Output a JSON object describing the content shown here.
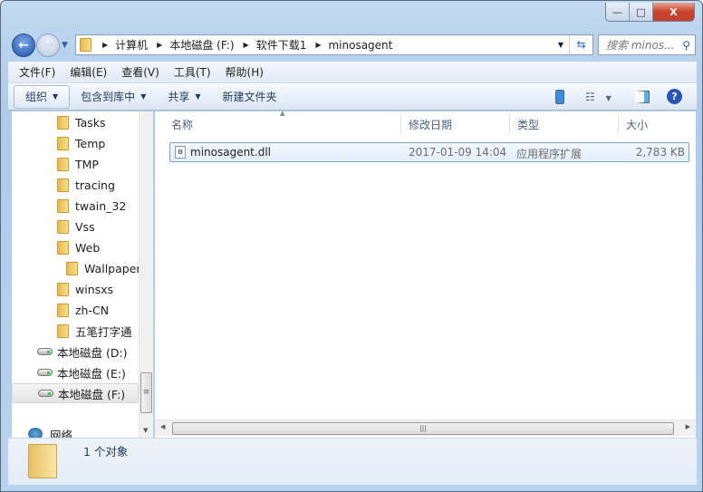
{
  "window": {
    "min": "—",
    "max": "□",
    "close": "X"
  },
  "address": {
    "crumbs": [
      "计算机",
      "本地磁盘 (F:)",
      "软件下载1",
      "minosagent"
    ]
  },
  "search": {
    "placeholder": "搜索 minos..."
  },
  "menu": [
    "文件(F)",
    "编辑(E)",
    "查看(V)",
    "工具(T)",
    "帮助(H)"
  ],
  "toolbar": {
    "organize": "组织",
    "include": "包含到库中",
    "share": "共享",
    "new_folder": "新建文件夹"
  },
  "tree": {
    "folders": [
      "Tasks",
      "Temp",
      "TMP",
      "tracing",
      "twain_32",
      "Vss",
      "Web",
      "Wallpaper",
      "winsxs",
      "zh-CN",
      "五笔打字通"
    ],
    "drives": [
      "本地磁盘 (D:)",
      "本地磁盘 (E:)",
      "本地磁盘 (F:)"
    ],
    "network": "网络",
    "selected": "本地磁盘 (F:)"
  },
  "columns": [
    "名称",
    "修改日期",
    "类型",
    "大小"
  ],
  "files": [
    {
      "name": "minosagent.dll",
      "date": "2017-01-09 14:04",
      "type": "应用程序扩展",
      "size": "2,783 KB"
    }
  ],
  "status": {
    "count": "1 个对象"
  }
}
